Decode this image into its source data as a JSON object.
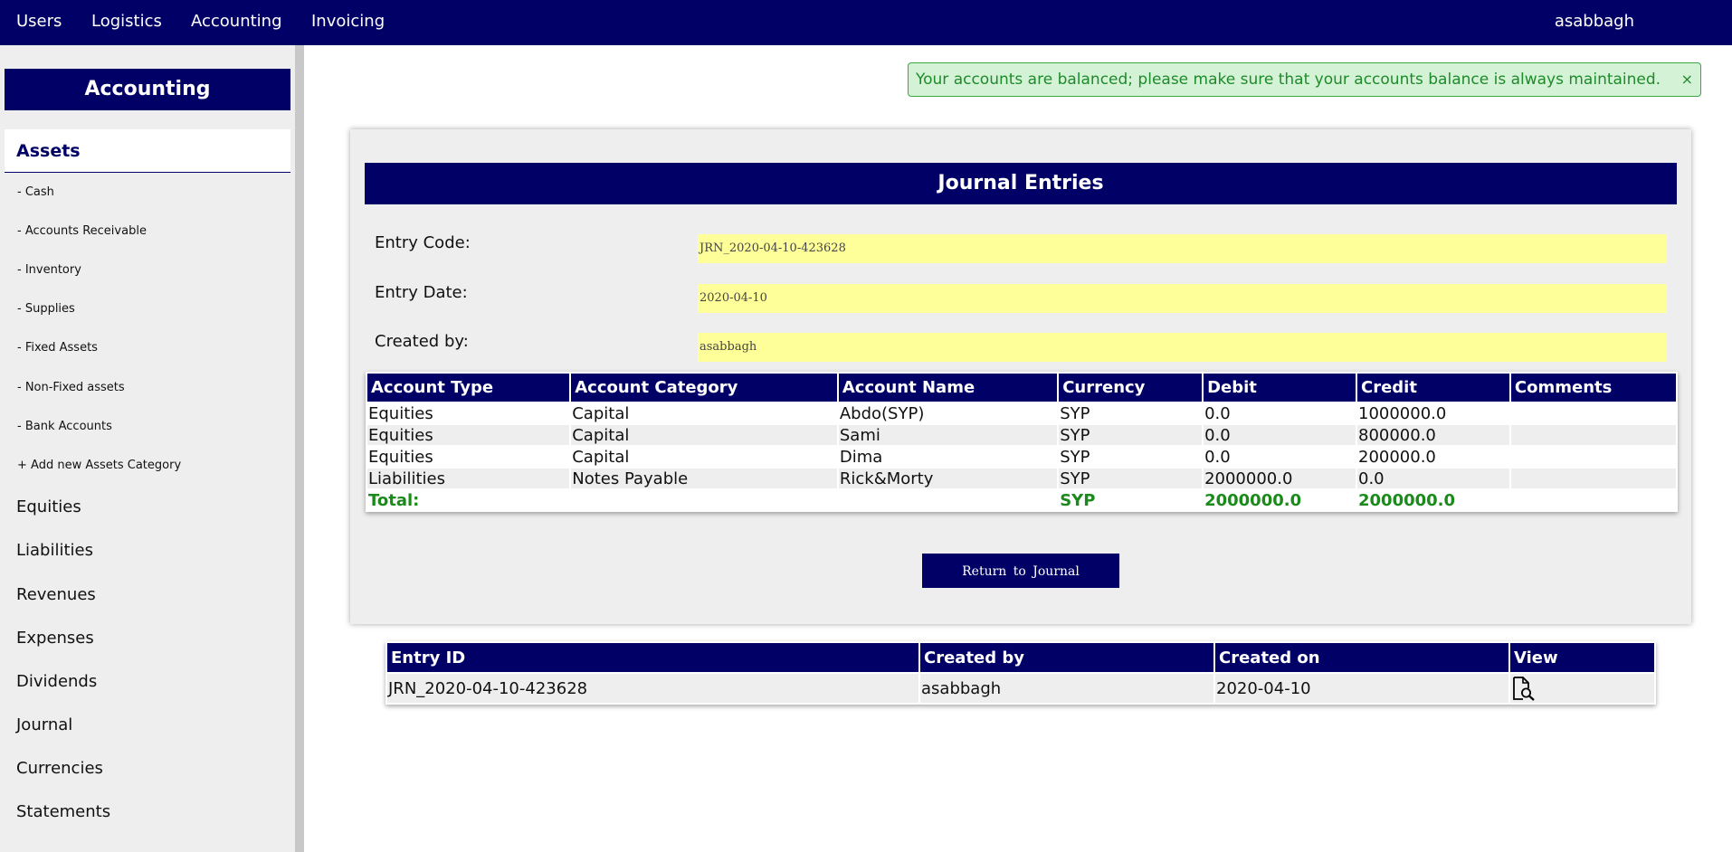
{
  "topnav": {
    "items": [
      "Users",
      "Logistics",
      "Accounting",
      "Invoicing"
    ],
    "user": "asabbagh"
  },
  "sidebar": {
    "title": "Accounting",
    "active_section": "Assets",
    "sub_items": [
      "- Cash",
      "- Accounts Receivable",
      "- Inventory",
      "- Supplies",
      "- Fixed Assets",
      "- Non-Fixed assets",
      "- Bank Accounts",
      "+ Add new Assets Category"
    ],
    "main_items": [
      "Equities",
      "Liabilities",
      "Revenues",
      "Expenses",
      "Dividends",
      "Journal",
      "Currencies",
      "Statements"
    ]
  },
  "alert": {
    "message": "Your accounts are balanced; please make sure that your accounts balance is always maintained.",
    "close": "×"
  },
  "journal": {
    "title": "Journal Entries",
    "fields": [
      {
        "label": "Entry Code:",
        "value": "JRN_2020-04-10-423628"
      },
      {
        "label": "Entry Date:",
        "value": "2020-04-10"
      },
      {
        "label": "Created by:",
        "value": "asabbagh"
      }
    ],
    "columns": [
      "Account Type",
      "Account Category",
      "Account Name",
      "Currency",
      "Debit",
      "Credit",
      "Comments"
    ],
    "rows": [
      [
        "Equities",
        "Capital",
        "Abdo(SYP)",
        "SYP",
        "0.0",
        "1000000.0",
        ""
      ],
      [
        "Equities",
        "Capital",
        "Sami",
        "SYP",
        "0.0",
        "800000.0",
        ""
      ],
      [
        "Equities",
        "Capital",
        "Dima",
        "SYP",
        "0.0",
        "200000.0",
        ""
      ],
      [
        "Liabilities",
        "Notes Payable",
        "Rick&Morty",
        "SYP",
        "2000000.0",
        "0.0",
        ""
      ]
    ],
    "total": [
      "Total:",
      "",
      "",
      "SYP",
      "2000000.0",
      "2000000.0",
      ""
    ],
    "return_button": "Return to Journal"
  },
  "entries_list": {
    "columns": [
      "Entry ID",
      "Created by",
      "Created on",
      "View"
    ],
    "rows": [
      {
        "id": "JRN_2020-04-10-423628",
        "created_by": "asabbagh",
        "created_on": "2020-04-10",
        "view_icon": "document-search-icon"
      }
    ]
  }
}
